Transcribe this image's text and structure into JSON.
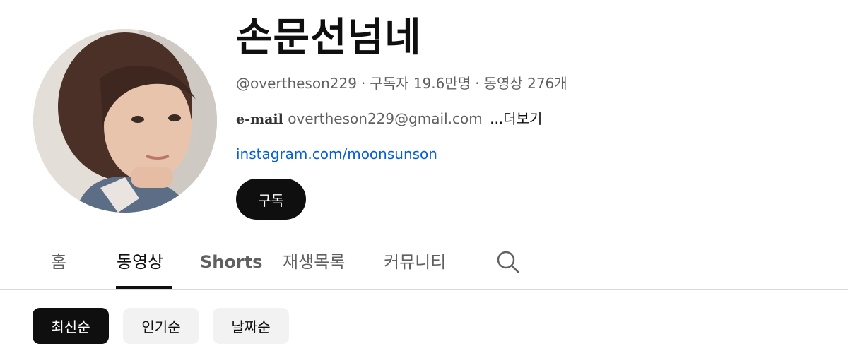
{
  "channel": {
    "name": "손문선넘네",
    "handle": "@overtheson229",
    "subscribers": "구독자 19.6만명",
    "videos": "동영상 276개",
    "separator": "·",
    "email_label": "e-mail",
    "email": "overtheson229@gmail.com",
    "more_label": "...더보기",
    "link": "instagram.com/moonsunson"
  },
  "subscribe": {
    "label": "구독"
  },
  "tabs": [
    {
      "label": "홈",
      "active": false
    },
    {
      "label": "동영상",
      "active": true
    },
    {
      "label": "Shorts",
      "active": false
    },
    {
      "label": "재생목록",
      "active": false
    },
    {
      "label": "커뮤니티",
      "active": false
    }
  ],
  "icons": {
    "search": "search-icon"
  },
  "filters": [
    {
      "label": "최신순",
      "active": true
    },
    {
      "label": "인기순",
      "active": false
    },
    {
      "label": "날짜순",
      "active": false
    }
  ],
  "colors": {
    "link": "#065fd4",
    "primary": "#0f0f0f",
    "chip_bg": "#f2f2f2",
    "secondary_text": "#606060"
  }
}
